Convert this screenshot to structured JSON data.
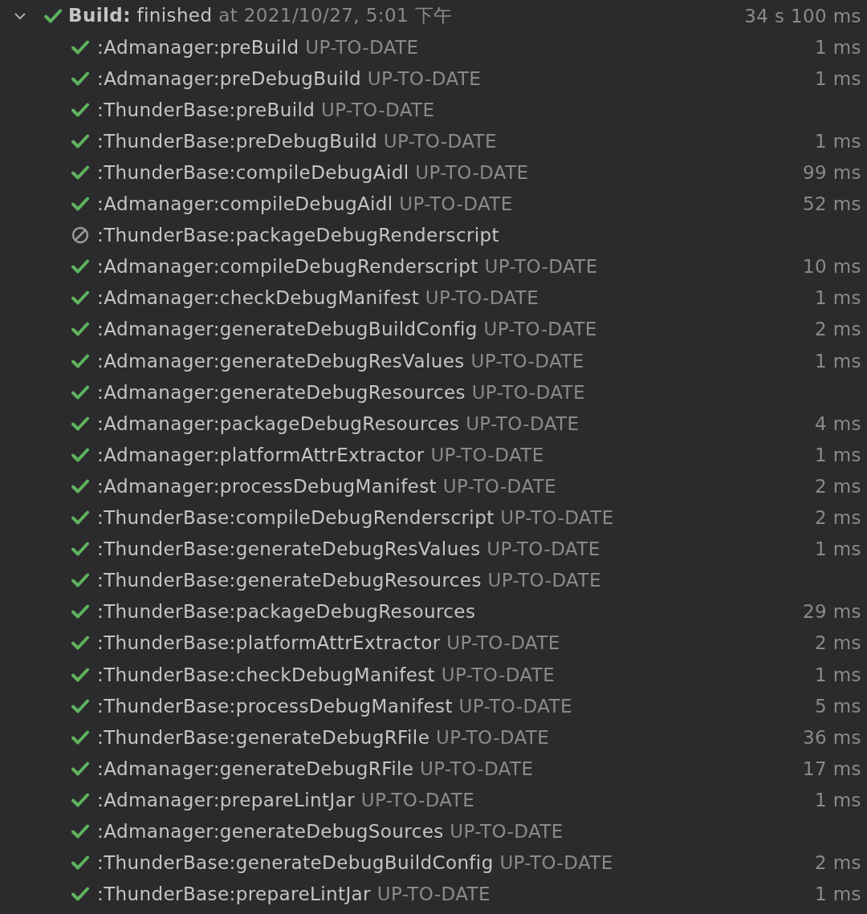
{
  "build": {
    "expanded": true,
    "kind": "success",
    "label": "Build:",
    "state": "finished",
    "when": "at 2021/10/27, 5:01 下午",
    "duration": "34 s 100 ms"
  },
  "tasks": [
    {
      "kind": "success",
      "name": ":Admanager:preBuild",
      "note": "UP-TO-DATE",
      "duration": "1 ms"
    },
    {
      "kind": "success",
      "name": ":Admanager:preDebugBuild",
      "note": "UP-TO-DATE",
      "duration": "1 ms"
    },
    {
      "kind": "success",
      "name": ":ThunderBase:preBuild",
      "note": "UP-TO-DATE"
    },
    {
      "kind": "success",
      "name": ":ThunderBase:preDebugBuild",
      "note": "UP-TO-DATE",
      "duration": "1 ms"
    },
    {
      "kind": "success",
      "name": ":ThunderBase:compileDebugAidl",
      "note": "UP-TO-DATE",
      "duration": "99 ms"
    },
    {
      "kind": "success",
      "name": ":Admanager:compileDebugAidl",
      "note": "UP-TO-DATE",
      "duration": "52 ms"
    },
    {
      "kind": "skipped",
      "name": ":ThunderBase:packageDebugRenderscript"
    },
    {
      "kind": "success",
      "name": ":Admanager:compileDebugRenderscript",
      "note": "UP-TO-DATE",
      "duration": "10 ms"
    },
    {
      "kind": "success",
      "name": ":Admanager:checkDebugManifest",
      "note": "UP-TO-DATE",
      "duration": "1 ms"
    },
    {
      "kind": "success",
      "name": ":Admanager:generateDebugBuildConfig",
      "note": "UP-TO-DATE",
      "duration": "2 ms"
    },
    {
      "kind": "success",
      "name": ":Admanager:generateDebugResValues",
      "note": "UP-TO-DATE",
      "duration": "1 ms"
    },
    {
      "kind": "success",
      "name": ":Admanager:generateDebugResources",
      "note": "UP-TO-DATE"
    },
    {
      "kind": "success",
      "name": ":Admanager:packageDebugResources",
      "note": "UP-TO-DATE",
      "duration": "4 ms"
    },
    {
      "kind": "success",
      "name": ":Admanager:platformAttrExtractor",
      "note": "UP-TO-DATE",
      "duration": "1 ms"
    },
    {
      "kind": "success",
      "name": ":Admanager:processDebugManifest",
      "note": "UP-TO-DATE",
      "duration": "2 ms"
    },
    {
      "kind": "success",
      "name": ":ThunderBase:compileDebugRenderscript",
      "note": "UP-TO-DATE",
      "duration": "2 ms"
    },
    {
      "kind": "success",
      "name": ":ThunderBase:generateDebugResValues",
      "note": "UP-TO-DATE",
      "duration": "1 ms"
    },
    {
      "kind": "success",
      "name": ":ThunderBase:generateDebugResources",
      "note": "UP-TO-DATE"
    },
    {
      "kind": "success",
      "name": ":ThunderBase:packageDebugResources",
      "duration": "29 ms"
    },
    {
      "kind": "success",
      "name": ":ThunderBase:platformAttrExtractor",
      "note": "UP-TO-DATE",
      "duration": "2 ms"
    },
    {
      "kind": "success",
      "name": ":ThunderBase:checkDebugManifest",
      "note": "UP-TO-DATE",
      "duration": "1 ms"
    },
    {
      "kind": "success",
      "name": ":ThunderBase:processDebugManifest",
      "note": "UP-TO-DATE",
      "duration": "5 ms"
    },
    {
      "kind": "success",
      "name": ":ThunderBase:generateDebugRFile",
      "note": "UP-TO-DATE",
      "duration": "36 ms"
    },
    {
      "kind": "success",
      "name": ":Admanager:generateDebugRFile",
      "note": "UP-TO-DATE",
      "duration": "17 ms"
    },
    {
      "kind": "success",
      "name": ":Admanager:prepareLintJar",
      "note": "UP-TO-DATE",
      "duration": "1 ms"
    },
    {
      "kind": "success",
      "name": ":Admanager:generateDebugSources",
      "note": "UP-TO-DATE"
    },
    {
      "kind": "success",
      "name": ":ThunderBase:generateDebugBuildConfig",
      "note": "UP-TO-DATE",
      "duration": "2 ms"
    },
    {
      "kind": "success",
      "name": ":ThunderBase:prepareLintJar",
      "note": "UP-TO-DATE",
      "duration": "1 ms"
    }
  ]
}
